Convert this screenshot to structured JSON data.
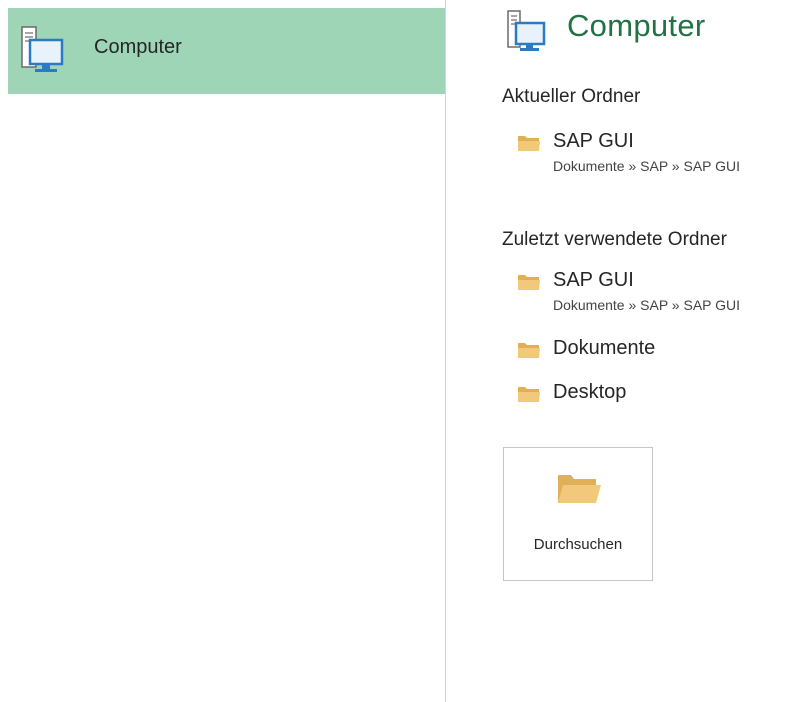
{
  "sidebar": {
    "items": [
      {
        "label": "Computer",
        "icon": "computer-icon",
        "selected": true
      }
    ],
    "selected_color": "#9fd5b7"
  },
  "main": {
    "title": "Computer",
    "title_icon": "computer-icon",
    "title_color": "#217346",
    "current_folder": {
      "heading": "Aktueller Ordner",
      "items": [
        {
          "name": "SAP GUI",
          "path": "Dokumente » SAP » SAP GUI",
          "icon": "folder-icon"
        }
      ]
    },
    "recent_folders": {
      "heading": "Zuletzt verwendete Ordner",
      "items": [
        {
          "name": "SAP GUI",
          "path": "Dokumente » SAP » SAP GUI",
          "icon": "folder-icon"
        },
        {
          "name": "Dokumente",
          "icon": "folder-icon"
        },
        {
          "name": "Desktop",
          "icon": "folder-icon"
        }
      ]
    },
    "browse": {
      "label": "Durchsuchen",
      "icon": "open-folder-icon"
    }
  },
  "colors": {
    "folder": "#f2c97a",
    "monitor_frame": "#2b7bc4",
    "monitor_screen": "#e8f2fb"
  }
}
